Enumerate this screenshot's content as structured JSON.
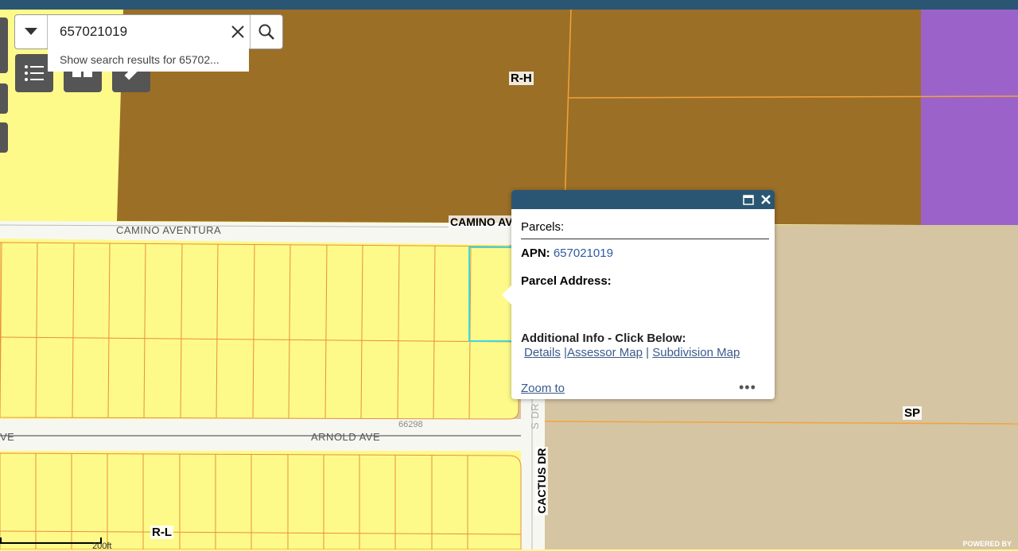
{
  "search": {
    "value": "657021019",
    "suggestion": "Show search results for 65702..."
  },
  "zones": {
    "rh": "R-H",
    "sp": "SP",
    "rl": "R-L"
  },
  "streets": {
    "camino_aventura": "CAMINO AVENTURA",
    "camino_av_bold": "CAMINO AV",
    "arnold_ave": "ARNOLD AVE",
    "ave_left": "VE",
    "cactus_dr": "CACTUS DR",
    "cactus_dr_faded": "S DR",
    "parcel_num": "66298"
  },
  "scale": {
    "label": "200ft"
  },
  "popup": {
    "title": "Parcels:",
    "apn_label": "APN:",
    "apn_value": "657021019",
    "address_label": "Parcel Address:",
    "info_label": "Additional Info - Click Below:",
    "links": [
      "Details",
      "Assessor Map",
      "Subdivision Map"
    ],
    "separator": "|",
    "zoom_label": "Zoom to",
    "more_label": "•••"
  },
  "footer": {
    "powered_by": "POWERED BY"
  },
  "colors": {
    "header": "#2a5673",
    "residential_low": "#fdfa8a",
    "residential_high": "#9c6f27",
    "specific_plan": "#d6c5a3",
    "purple_zone": "#9b63c9",
    "parcel_line": "#e8903a"
  }
}
